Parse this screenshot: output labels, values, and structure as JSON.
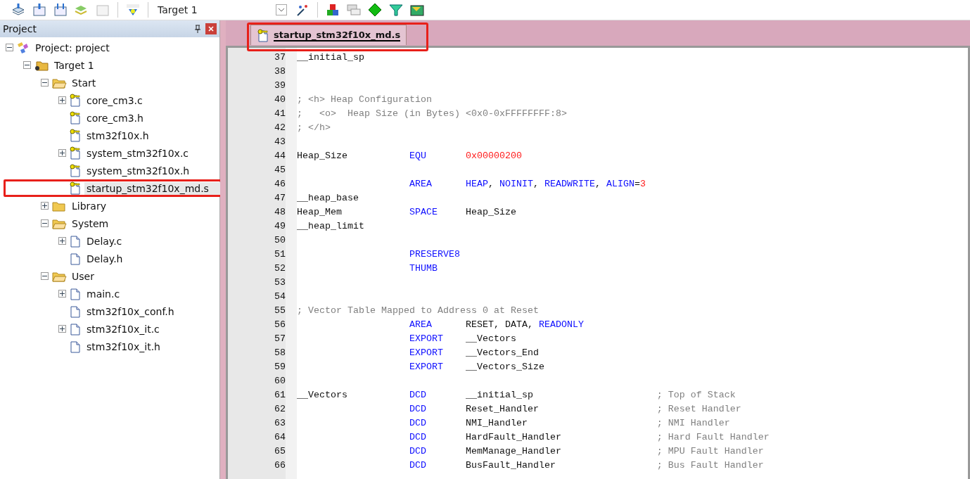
{
  "toolbar": {
    "target": "Target 1"
  },
  "project_panel": {
    "title": "Project",
    "tree": [
      {
        "label": "Project: project",
        "kind": "project",
        "expanded": true,
        "selected": false,
        "highlighted": false,
        "children": [
          {
            "label": "Target 1",
            "kind": "target",
            "expanded": true,
            "selected": false,
            "highlighted": false,
            "children": [
              {
                "label": "Start",
                "kind": "folder",
                "expanded": true,
                "selected": false,
                "highlighted": false,
                "children": [
                  {
                    "label": "core_cm3.c",
                    "kind": "key_file",
                    "expanded": false,
                    "selected": false,
                    "highlighted": false
                  },
                  {
                    "label": "core_cm3.h",
                    "kind": "key_file",
                    "selected": false,
                    "highlighted": false
                  },
                  {
                    "label": "stm32f10x.h",
                    "kind": "key_file",
                    "selected": false,
                    "highlighted": false
                  },
                  {
                    "label": "system_stm32f10x.c",
                    "kind": "key_file",
                    "expanded": false,
                    "selected": false,
                    "highlighted": false
                  },
                  {
                    "label": "system_stm32f10x.h",
                    "kind": "key_file",
                    "selected": false,
                    "highlighted": false
                  },
                  {
                    "label": "startup_stm32f10x_md.s",
                    "kind": "key_file",
                    "selected": true,
                    "highlighted": true
                  }
                ]
              },
              {
                "label": "Library",
                "kind": "folder",
                "expanded": false,
                "selected": false,
                "highlighted": false
              },
              {
                "label": "System",
                "kind": "folder",
                "expanded": true,
                "selected": false,
                "highlighted": false,
                "children": [
                  {
                    "label": "Delay.c",
                    "kind": "file",
                    "expanded": false,
                    "selected": false,
                    "highlighted": false
                  },
                  {
                    "label": "Delay.h",
                    "kind": "file",
                    "selected": false,
                    "highlighted": false
                  }
                ]
              },
              {
                "label": "User",
                "kind": "folder",
                "expanded": true,
                "selected": false,
                "highlighted": false,
                "children": [
                  {
                    "label": "main.c",
                    "kind": "file",
                    "expanded": false,
                    "selected": false,
                    "highlighted": false
                  },
                  {
                    "label": "stm32f10x_conf.h",
                    "kind": "file",
                    "selected": false,
                    "highlighted": false
                  },
                  {
                    "label": "stm32f10x_it.c",
                    "kind": "file",
                    "expanded": false,
                    "selected": false,
                    "highlighted": false
                  },
                  {
                    "label": "stm32f10x_it.h",
                    "kind": "file",
                    "selected": false,
                    "highlighted": false
                  }
                ]
              }
            ]
          }
        ]
      }
    ]
  },
  "editor": {
    "tabs": [
      {
        "label": "startup_stm32f10x_md.s",
        "selected": true,
        "highlighted": true
      }
    ],
    "lines": [
      {
        "number": "37",
        "label": "__initial_sp"
      },
      {
        "number": "38"
      },
      {
        "number": "39"
      },
      {
        "number": "40",
        "comment": "; <h> Heap Configuration"
      },
      {
        "number": "41",
        "comment": ";   <o>  Heap Size (in Bytes) <0x0-0xFFFFFFFF:8>"
      },
      {
        "number": "42",
        "comment": "; </h>"
      },
      {
        "number": "43"
      },
      {
        "number": "44",
        "label": "Heap_Size",
        "op": "EQU",
        "operands": [
          {
            "text": "0x00000200",
            "kind": "number"
          }
        ]
      },
      {
        "number": "45"
      },
      {
        "number": "46",
        "op": "AREA",
        "operands": [
          {
            "text": "HEAP",
            "kind": "keyword"
          },
          {
            "text": ", ",
            "kind": "plain"
          },
          {
            "text": "NOINIT",
            "kind": "keyword"
          },
          {
            "text": ", ",
            "kind": "plain"
          },
          {
            "text": "READWRITE",
            "kind": "keyword"
          },
          {
            "text": ", ",
            "kind": "plain"
          },
          {
            "text": "ALIGN",
            "kind": "keyword"
          },
          {
            "text": "=",
            "kind": "plain"
          },
          {
            "text": "3",
            "kind": "number"
          }
        ]
      },
      {
        "number": "47",
        "label": "__heap_base"
      },
      {
        "number": "48",
        "label": "Heap_Mem",
        "op": "SPACE",
        "operands": [
          {
            "text": "Heap_Size",
            "kind": "plain"
          }
        ]
      },
      {
        "number": "49",
        "label": "__heap_limit"
      },
      {
        "number": "50"
      },
      {
        "number": "51",
        "op": "PRESERVE8"
      },
      {
        "number": "52",
        "op": "THUMB"
      },
      {
        "number": "53"
      },
      {
        "number": "54"
      },
      {
        "number": "55",
        "comment": "; Vector Table Mapped to Address 0 at Reset"
      },
      {
        "number": "56",
        "op": "AREA",
        "operands": [
          {
            "text": "RESET, DATA, ",
            "kind": "plain"
          },
          {
            "text": "READONLY",
            "kind": "keyword"
          }
        ]
      },
      {
        "number": "57",
        "op": "EXPORT",
        "operands": [
          {
            "text": "__Vectors",
            "kind": "plain"
          }
        ]
      },
      {
        "number": "58",
        "op": "EXPORT",
        "operands": [
          {
            "text": "__Vectors_End",
            "kind": "plain"
          }
        ]
      },
      {
        "number": "59",
        "op": "EXPORT",
        "operands": [
          {
            "text": "__Vectors_Size",
            "kind": "plain"
          }
        ]
      },
      {
        "number": "60"
      },
      {
        "number": "61",
        "label": "__Vectors",
        "op": "DCD",
        "operands": [
          {
            "text": "__initial_sp",
            "kind": "plain"
          }
        ],
        "comment": "; Top of Stack"
      },
      {
        "number": "62",
        "op": "DCD",
        "operands": [
          {
            "text": "Reset_Handler",
            "kind": "plain"
          }
        ],
        "comment": "; Reset Handler"
      },
      {
        "number": "63",
        "op": "DCD",
        "operands": [
          {
            "text": "NMI_Handler",
            "kind": "plain"
          }
        ],
        "comment": "; NMI Handler"
      },
      {
        "number": "64",
        "op": "DCD",
        "operands": [
          {
            "text": "HardFault_Handler",
            "kind": "plain"
          }
        ],
        "comment": "; Hard Fault Handler"
      },
      {
        "number": "65",
        "op": "DCD",
        "operands": [
          {
            "text": "MemManage_Handler",
            "kind": "plain"
          }
        ],
        "comment": "; MPU Fault Handler"
      },
      {
        "number": "66",
        "op": "DCD",
        "operands": [
          {
            "text": "BusFault_Handler",
            "kind": "plain"
          }
        ],
        "comment": "; Bus Fault Handler"
      }
    ]
  }
}
